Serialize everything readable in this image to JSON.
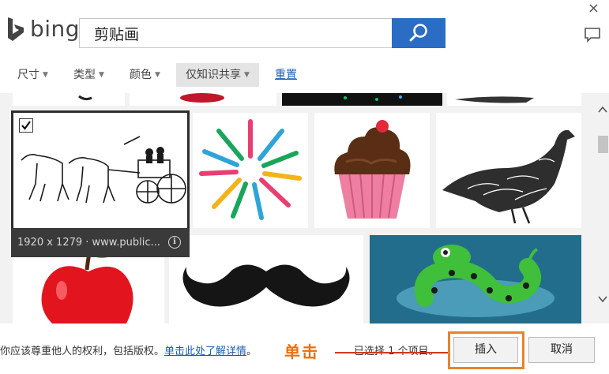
{
  "header": {
    "logo_text": "bing",
    "close_glyph": "×",
    "search_value": "剪贴画"
  },
  "filters": {
    "size": "尺寸",
    "type": "类型",
    "color": "颜色",
    "license": "仅知识共享",
    "reset": "重置"
  },
  "gallery": {
    "selected_caption": "1920 x 1279 · www.public...",
    "info_glyph": "i",
    "tiles": [
      "horse-carriage",
      "fork-spoon-burst",
      "cupcake",
      "grouse-bird",
      "red-apple",
      "mustache",
      "green-snake"
    ]
  },
  "footer": {
    "legal_text": "你应该尊重他人的权利，包括版权。",
    "legal_link": "单击此处了解详情",
    "legal_tail": "。",
    "annotation": "单击",
    "selected_count": "已选择 1 个项目。",
    "insert_label": "插入",
    "cancel_label": "取消"
  },
  "colors": {
    "search_button": "#2b6cc4",
    "link": "#1a5fb4",
    "annotation": "#e8700f",
    "highlight": "#e8842d"
  }
}
